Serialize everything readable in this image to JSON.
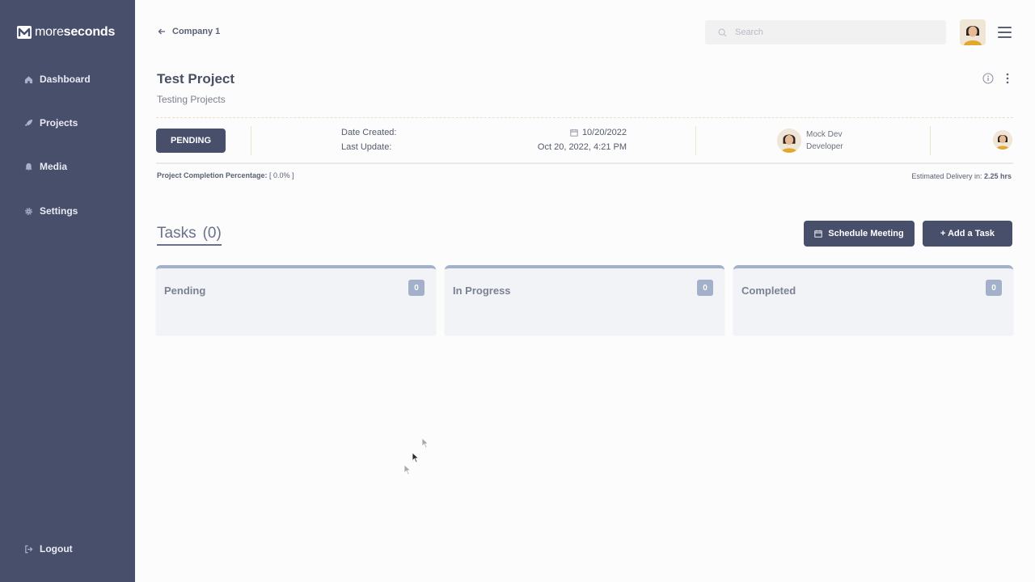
{
  "brand": {
    "prefix": "more",
    "name": "seconds"
  },
  "sidebar": {
    "items": [
      {
        "label": "Dashboard",
        "icon": "home-icon"
      },
      {
        "label": "Projects",
        "icon": "rocket-icon"
      },
      {
        "label": "Media",
        "icon": "bell-icon"
      },
      {
        "label": "Settings",
        "icon": "gear-icon"
      }
    ],
    "logout": {
      "label": "Logout",
      "icon": "logout-icon"
    }
  },
  "header": {
    "back_label": "Company 1",
    "search_placeholder": "Search"
  },
  "project": {
    "title": "Test Project",
    "subtitle": "Testing Projects",
    "status": "PENDING",
    "date_created_label": "Date Created:",
    "date_created_value": "10/20/2022",
    "last_update_label": "Last Update:",
    "last_update_value": "Oct 20, 2022, 4:21 PM",
    "member": {
      "name": "Mock Dev",
      "role": "Developer"
    },
    "completion_label": "Project Completion Percentage:",
    "completion_value": "[ 0.0% ]",
    "delivery_label": "Estimated Delivery in:",
    "delivery_value": "2.25 hrs"
  },
  "tasks": {
    "title": "Tasks",
    "count": "(0)",
    "schedule_label": "Schedule Meeting",
    "add_label": "+ Add a Task",
    "columns": [
      {
        "title": "Pending",
        "count": "0"
      },
      {
        "title": "In Progress",
        "count": "0"
      },
      {
        "title": "Completed",
        "count": "0"
      }
    ]
  },
  "colors": {
    "sidebar_bg": "#474f6b",
    "accent": "#474f6b",
    "column_accent": "#a3b0c9"
  }
}
